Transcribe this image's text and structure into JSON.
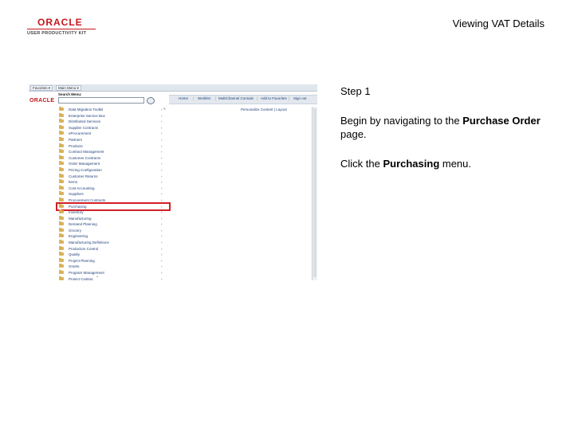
{
  "logo": {
    "brand": "ORACLE",
    "kit": "USER PRODUCTIVITY KIT"
  },
  "page_title": "Viewing VAT Details",
  "screenshot": {
    "tabs": [
      "Favorites ▾",
      "Main Menu ▾"
    ],
    "oracle_mini": "ORACLE",
    "nav_links": [
      "Home",
      "Worklist",
      "MultiChannel Console",
      "Add to Favorites",
      "Sign out"
    ],
    "search_label": "Search Menu:",
    "search_value": "",
    "collapse_glyph": "«",
    "personalize_text": "Personalize Content | Layout",
    "menu_items": [
      {
        "label": "Data Migration Toolkit",
        "arrow": "›"
      },
      {
        "label": "Enterprise Service Bus",
        "arrow": "›"
      },
      {
        "label": "Distributed Services",
        "arrow": "›"
      },
      {
        "label": "Supplier Contracts",
        "arrow": "›"
      },
      {
        "label": "eProcurement",
        "arrow": "›"
      },
      {
        "label": "Partners",
        "arrow": "›"
      },
      {
        "label": "Products",
        "arrow": "›"
      },
      {
        "label": "Contract Management",
        "arrow": "›"
      },
      {
        "label": "Customer Contracts",
        "arrow": "›"
      },
      {
        "label": "Order Management",
        "arrow": "›"
      },
      {
        "label": "Pricing Configuration",
        "arrow": "›"
      },
      {
        "label": "Customer Returns",
        "arrow": "›"
      },
      {
        "label": "Items",
        "arrow": "›"
      },
      {
        "label": "Cost Accounting",
        "arrow": "›"
      },
      {
        "label": "Suppliers",
        "arrow": "›"
      },
      {
        "label": "Procurement Contracts",
        "arrow": "›"
      },
      {
        "label": "Purchasing",
        "arrow": "›",
        "highlight": true
      },
      {
        "label": "Inventory",
        "arrow": "›"
      },
      {
        "label": "Manufacturing",
        "arrow": "›"
      },
      {
        "label": "Demand Planning",
        "arrow": "›"
      },
      {
        "label": "Grocery",
        "arrow": "›"
      },
      {
        "label": "Engineering",
        "arrow": "›"
      },
      {
        "label": "Manufacturing Definitions",
        "arrow": "›"
      },
      {
        "label": "Production Control",
        "arrow": "›"
      },
      {
        "label": "Quality",
        "arrow": "›"
      },
      {
        "label": "Project Planning",
        "arrow": "›"
      },
      {
        "label": "Grants",
        "arrow": "›"
      },
      {
        "label": "Program Management",
        "arrow": "›"
      },
      {
        "label": "Project Costing",
        "arrow": "›"
      }
    ],
    "more_glyph": "⌄"
  },
  "instructions": {
    "step": "Step 1",
    "line1_pre": "Begin by navigating to the ",
    "line1_bold": "Purchase Order",
    "line1_post": " page.",
    "line2_pre": "Click the ",
    "line2_bold": "Purchasing",
    "line2_post": " menu."
  }
}
